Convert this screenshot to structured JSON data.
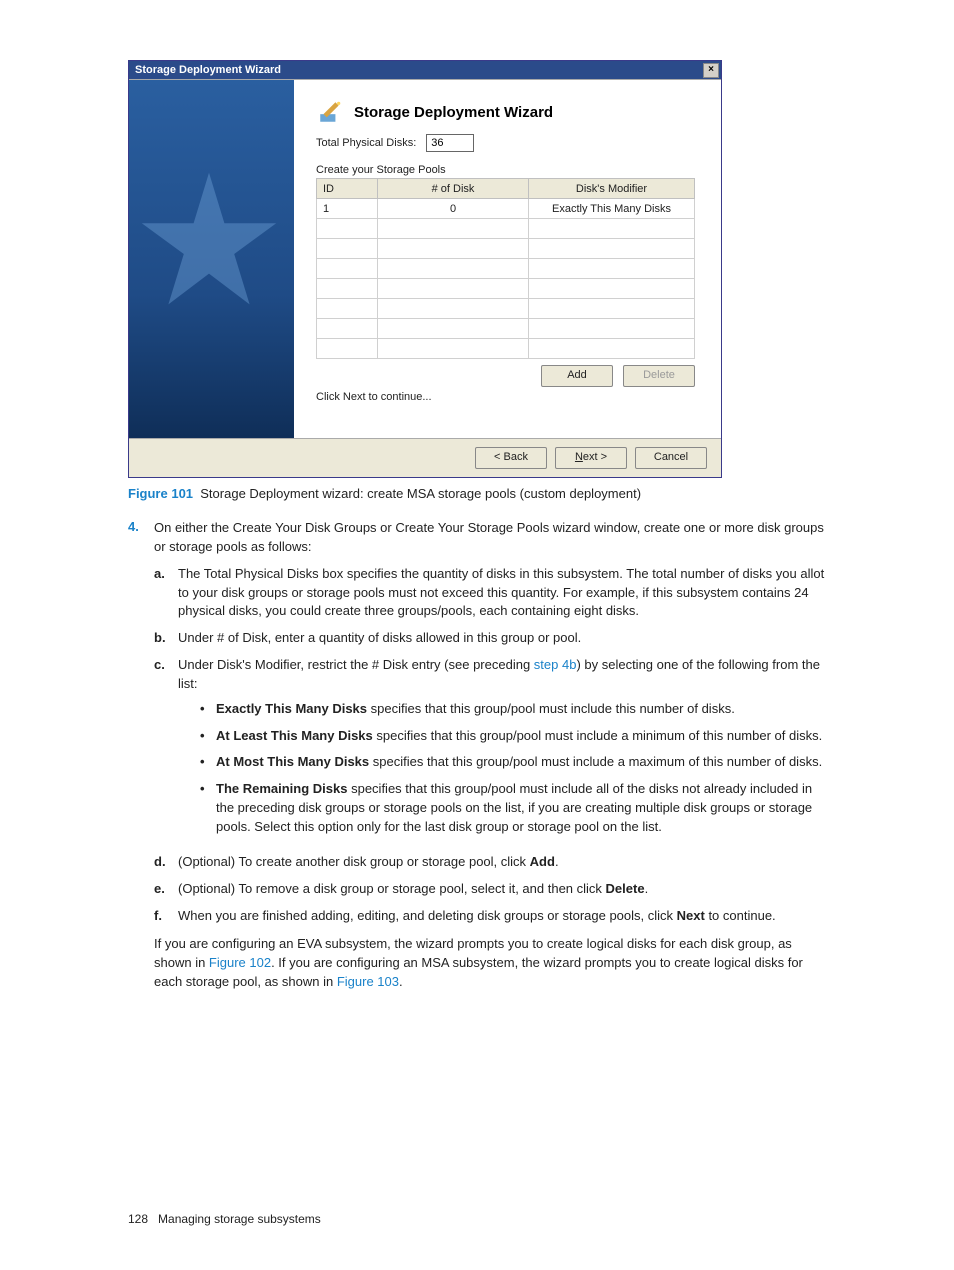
{
  "dialog": {
    "titlebar": "Storage Deployment Wizard",
    "heading": "Storage Deployment Wizard",
    "total_label": "Total Physical Disks:",
    "total_value": "36",
    "subhead": "Create your Storage Pools",
    "cols": {
      "id": "ID",
      "num": "# of Disk",
      "mod": "Disk's Modifier"
    },
    "rows": [
      {
        "id": "1",
        "num": "0",
        "mod": "Exactly This Many Disks"
      }
    ],
    "add": "Add",
    "delete": "Delete",
    "hint": "Click Next to continue...",
    "back": "< Back",
    "next": "Next >",
    "cancel": "Cancel"
  },
  "figure": {
    "label": "Figure 101",
    "caption": "Storage Deployment wizard: create MSA storage pools (custom deployment)"
  },
  "step4": {
    "num": "4.",
    "intro": "On either the Create Your Disk Groups or Create Your Storage Pools wizard window, create one or more disk groups or storage pools as follows:",
    "a": {
      "num": "a.",
      "text": "The Total Physical Disks box specifies the quantity of disks in this subsystem. The total number of disks you allot to your disk groups or storage pools must not exceed this quantity. For example, if this subsystem contains 24 physical disks, you could create three groups/pools, each containing eight disks."
    },
    "b": {
      "num": "b.",
      "text": "Under # of Disk, enter a quantity of disks allowed in this group or pool."
    },
    "c": {
      "num": "c.",
      "pre": "Under Disk's Modifier, restrict the # Disk entry (see preceding ",
      "link": "step 4b",
      "post": ") by selecting one of the following from the list:",
      "bullets": {
        "exactly": {
          "label": "Exactly This Many Disks",
          "desc": " specifies that this group/pool must include this number of disks."
        },
        "atleast": {
          "label": "At Least This Many Disks",
          "desc": " specifies that this group/pool must include a minimum of this number of disks."
        },
        "atmost": {
          "label": "At Most This Many Disks",
          "desc": " specifies that this group/pool must include a maximum of this number of disks."
        },
        "remaining": {
          "label": "The Remaining Disks",
          "desc": " specifies that this group/pool must include all of the disks not already included in the preceding disk groups or storage pools on the list, if you are creating multiple disk groups or storage pools. Select this option only for the last disk group or storage pool on the list."
        }
      }
    },
    "d": {
      "num": "d.",
      "pre": "(Optional) To create another disk group or storage pool, click ",
      "bold": "Add",
      "post": "."
    },
    "e": {
      "num": "e.",
      "pre": "(Optional) To remove a disk group or storage pool, select it, and then click ",
      "bold": "Delete",
      "post": "."
    },
    "f": {
      "num": "f.",
      "pre": "When you are finished adding, editing, and deleting disk groups or storage pools, click ",
      "bold": "Next",
      "post": " to continue."
    },
    "tail": {
      "p1": "If you are configuring an EVA subsystem, the wizard prompts you to create logical disks for each disk group, as shown in ",
      "l1": "Figure 102",
      "p2": ". If you are configuring an MSA subsystem, the wizard prompts you to create logical disks for each storage pool, as shown in ",
      "l2": "Figure 103",
      "p3": "."
    }
  },
  "footer": {
    "page": "128",
    "section": "Managing storage subsystems"
  }
}
